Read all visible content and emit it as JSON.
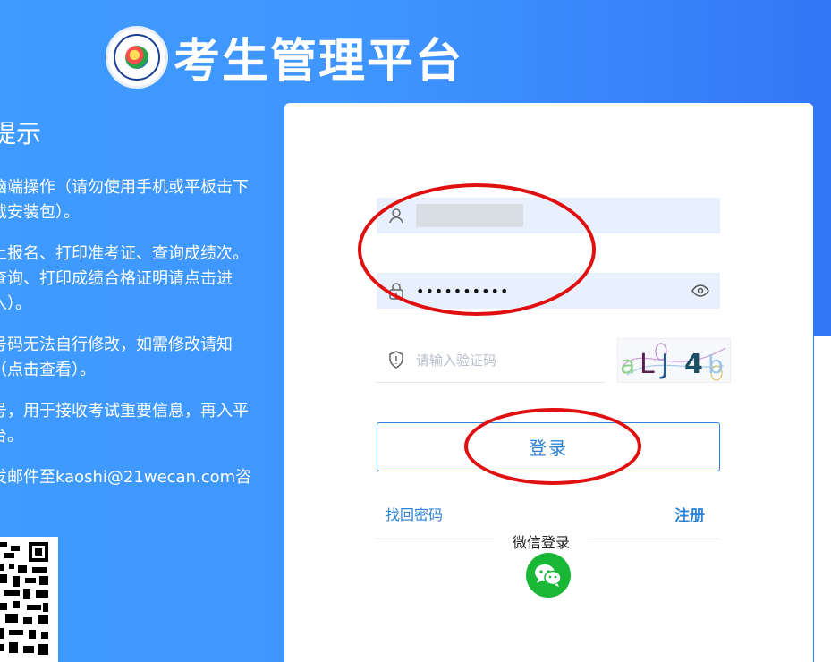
{
  "header": {
    "title": "考生管理平台"
  },
  "notice": {
    "heading": "提示",
    "paragraphs": [
      "脑端操作（请勿使用手机或平板击下载安装包）。",
      "上报名、打印准考证、查询成绩次。查询、打印成绩合格证明请点击进入）。",
      "号码无法自行修改，如需修改请知（点击查看）。",
      "号，用于接收考试重要信息，再入平台。",
      "发邮件至kaoshi@21wecan.com咨"
    ]
  },
  "login": {
    "username_value": "",
    "password_value": "••••••••••",
    "captcha_placeholder": "请输入验证码",
    "captcha_text": "aLJ4b",
    "submit_label": "登录",
    "forgot_password_label": "找回密码",
    "register_label": "注册",
    "wechat_label": "微信登录"
  },
  "icons": {
    "username": "user-icon",
    "password": "lock-icon",
    "toggle_password": "eye-icon",
    "captcha": "shield-icon",
    "wechat": "wechat-icon"
  },
  "colors": {
    "primary": "#2f83d8",
    "background_blue": "#3f95ff",
    "input_fill": "#e8f0fe",
    "wechat_green": "#18b836",
    "annotation_red": "#e01010"
  }
}
